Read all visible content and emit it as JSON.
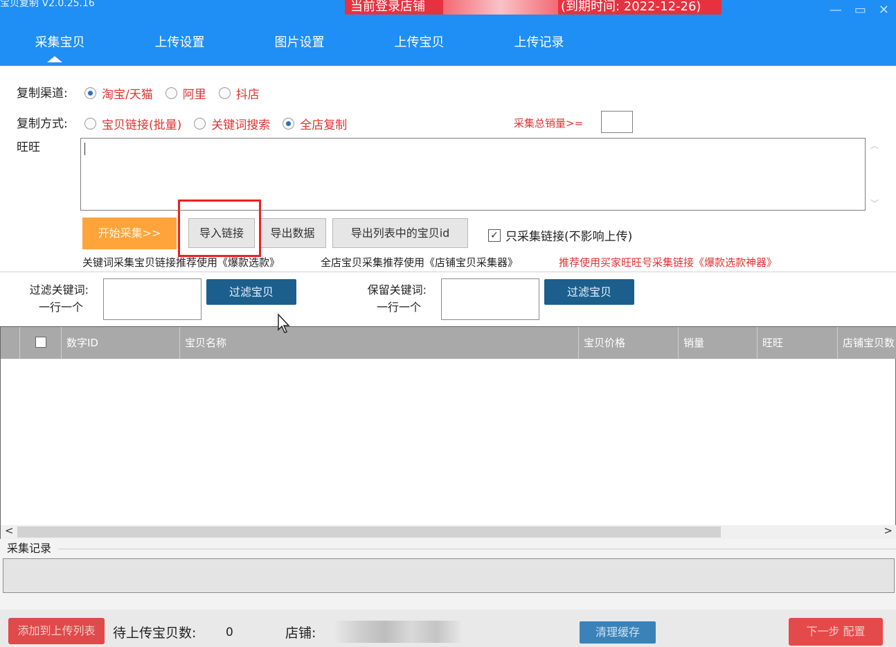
{
  "app": {
    "title": "宝贝复制 V2.0.25.16"
  },
  "banner": {
    "login": "当前登录店铺",
    "expiry": "(到期时间: 2022-12-26)"
  },
  "tabs": [
    "采集宝贝",
    "上传设置",
    "图片设置",
    "上传宝贝",
    "上传记录"
  ],
  "channel": {
    "label": "复制渠道:",
    "options": [
      "淘宝/天猫",
      "阿里",
      "抖店"
    ],
    "selected": 0
  },
  "method": {
    "label": "复制方式:",
    "options": [
      "宝贝链接(批量)",
      "关键词搜索",
      "全店复制"
    ],
    "selected": 2
  },
  "sales": {
    "label": "采集总销量>=",
    "value": ""
  },
  "wangwang": {
    "label": "旺旺",
    "value": ""
  },
  "actions": {
    "start": "开始采集>>",
    "import": "导入链接",
    "export": "导出数据",
    "export_ids": "导出列表中的宝贝id",
    "only_links": "只采集链接(不影响上传)",
    "only_links_checked": true
  },
  "tips": {
    "keyword": "关键词采集宝贝链接推荐使用《爆款选款》",
    "shop": "全店宝贝采集推荐使用《店铺宝贝采集器》",
    "buyer": "推荐使用买家旺旺号采集链接《爆款选款神器》"
  },
  "filter": {
    "filter_label": "过滤关键词:",
    "filter_hint": "一行一个",
    "filter_btn": "过滤宝贝",
    "keep_label": "保留关键词:",
    "keep_hint": "一行一个",
    "keep_btn": "过滤宝贝"
  },
  "table": {
    "columns": [
      "全选",
      "数字ID",
      "宝贝名称",
      "宝贝价格",
      "销量",
      "旺旺",
      "店铺宝贝数"
    ],
    "rows": []
  },
  "log": {
    "title": "采集记录"
  },
  "bottom": {
    "add_btn": "添加到上传列表",
    "pending_label": "待上传宝贝数:",
    "pending_count": "0",
    "shop_label": "店铺:",
    "clear_btn": "清理缓存",
    "next_btn": "下一步 配置"
  }
}
